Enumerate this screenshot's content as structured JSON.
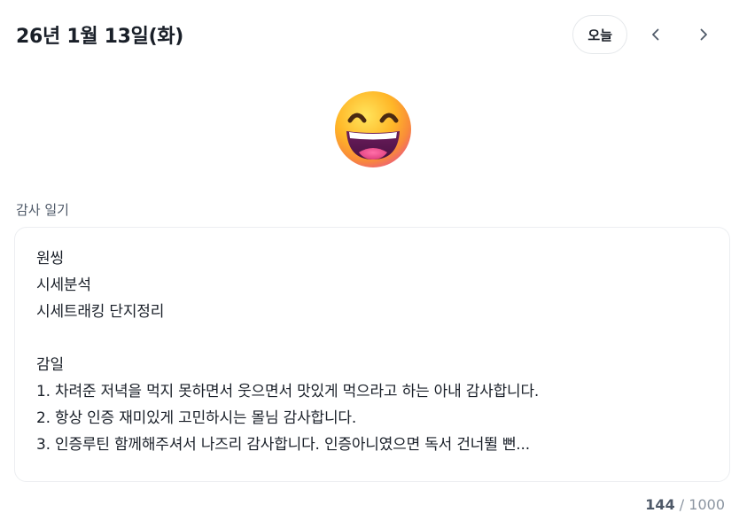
{
  "header": {
    "date": "26년 1월 13일(화)",
    "today_label": "오늘"
  },
  "mood": {
    "icon": "grinning-face-with-smiling-eyes-icon"
  },
  "diary": {
    "label": "감사 일기",
    "content": "원씽\n시세분석\n시세트래킹 단지정리\n\n감일\n1. 차려준 저녁을 먹지 못하면서 웃으면서 맛있게 먹으라고 하는 아내 감사합니다.\n2. 항상 인증 재미있게 고민하시는 몰님 감사합니다.\n3. 인증루틴 함께해주셔서 나즈리 감사합니다. 인증아니였으면 독서 건너뛸 뻔...",
    "char_count": "144",
    "separator": "/",
    "char_limit": "1000"
  }
}
